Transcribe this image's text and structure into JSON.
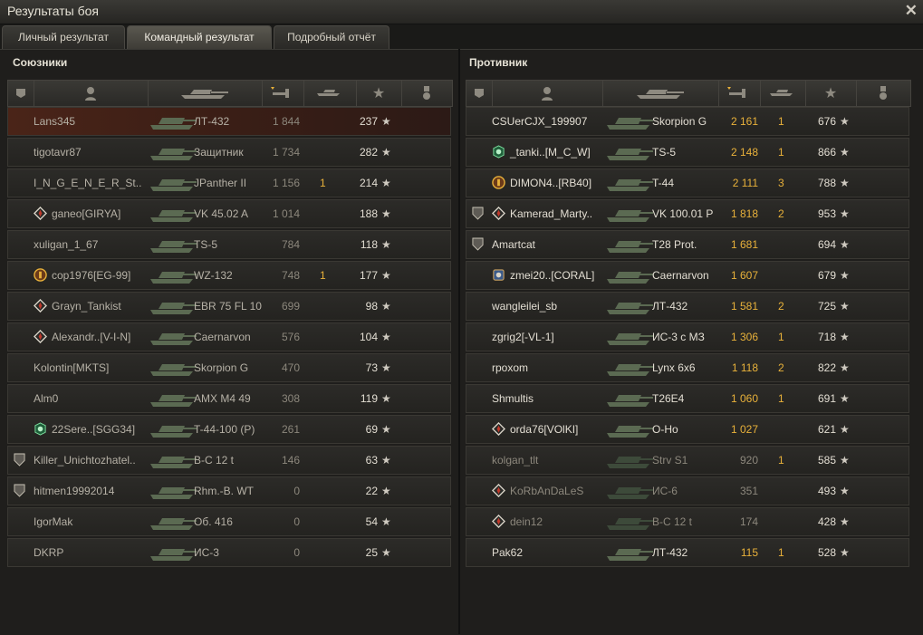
{
  "window": {
    "title": "Результаты боя",
    "close": "✕"
  },
  "tabs": [
    {
      "label": "Личный результат",
      "active": false
    },
    {
      "label": "Командный результат",
      "active": true
    },
    {
      "label": "Подробный отчёт",
      "active": false
    }
  ],
  "allies": {
    "title": "Союзники",
    "rows": [
      {
        "name": "Lans345",
        "tank": "ЛТ-432",
        "damage": "1 844",
        "frags": "",
        "xp": "237",
        "badge": "",
        "me": true
      },
      {
        "name": "tigotavr87",
        "tank": "Защитник",
        "damage": "1 734",
        "frags": "",
        "xp": "282",
        "badge": ""
      },
      {
        "name": "I_N_G_E_N_E_R_St..",
        "tank": "JPanther II",
        "damage": "1 156",
        "frags": "1",
        "xp": "214",
        "badge": ""
      },
      {
        "name": "ganeo[GIRYA]",
        "tank": "VK 45.02 A",
        "damage": "1 014",
        "frags": "",
        "xp": "188",
        "badge": "diamond"
      },
      {
        "name": "xuligan_1_67",
        "tank": "TS-5",
        "damage": "784",
        "frags": "",
        "xp": "118",
        "badge": ""
      },
      {
        "name": "cop1976[EG-99]",
        "tank": "WZ-132",
        "damage": "748",
        "frags": "1",
        "xp": "177",
        "badge": "emblem"
      },
      {
        "name": "Grayn_Tankist",
        "tank": "EBR 75 FL 10",
        "damage": "699",
        "frags": "",
        "xp": "98",
        "badge": "diamond"
      },
      {
        "name": "Alexandr..[V-I-N]",
        "tank": "Caernarvon",
        "damage": "576",
        "frags": "",
        "xp": "104",
        "badge": "diamond"
      },
      {
        "name": "Kolontin[MKTS]",
        "tank": "Skorpion G",
        "damage": "470",
        "frags": "",
        "xp": "73",
        "badge": ""
      },
      {
        "name": "Alm0",
        "tank": "AMX M4 49",
        "damage": "308",
        "frags": "",
        "xp": "119",
        "badge": ""
      },
      {
        "name": "22Sere..[SGG34]",
        "tank": "T-44-100 (P)",
        "damage": "261",
        "frags": "",
        "xp": "69",
        "badge": "green"
      },
      {
        "name": "Killer_Unichtozhatel..",
        "tank": "B-C 12 t",
        "damage": "146",
        "frags": "",
        "xp": "63",
        "badge": "",
        "shield": true
      },
      {
        "name": "hitmen19992014",
        "tank": "Rhm.-B. WT",
        "damage": "0",
        "frags": "",
        "xp": "22",
        "badge": "",
        "shield": true
      },
      {
        "name": "IgorMak",
        "tank": "Об. 416",
        "damage": "0",
        "frags": "",
        "xp": "54",
        "badge": ""
      },
      {
        "name": "DKRP",
        "tank": "ИС-3",
        "damage": "0",
        "frags": "",
        "xp": "25",
        "badge": ""
      }
    ]
  },
  "enemies": {
    "title": "Противник",
    "rows": [
      {
        "name": "CSUerCJX_199907",
        "tank": "Skorpion G",
        "damage": "2 161",
        "frags": "1",
        "xp": "676",
        "badge": ""
      },
      {
        "name": "_tanki..[M_C_W]",
        "tank": "TS-5",
        "damage": "2 148",
        "frags": "1",
        "xp": "866",
        "badge": "green"
      },
      {
        "name": "DIMON4..[RB40]",
        "tank": "T-44",
        "damage": "2 111",
        "frags": "3",
        "xp": "788",
        "badge": "emblem"
      },
      {
        "name": "Kamerad_Marty..",
        "tank": "VK 100.01 P",
        "damage": "1 818",
        "frags": "2",
        "xp": "953",
        "badge": "diamond",
        "shield": true
      },
      {
        "name": "Amartcat",
        "tank": "T28 Prot.",
        "damage": "1 681",
        "frags": "",
        "xp": "694",
        "badge": "",
        "shield": true
      },
      {
        "name": "zmei20..[CORAL]",
        "tank": "Caernarvon",
        "damage": "1 607",
        "frags": "",
        "xp": "679",
        "badge": "blue"
      },
      {
        "name": "wangleilei_sb",
        "tank": "ЛТ-432",
        "damage": "1 581",
        "frags": "2",
        "xp": "725",
        "badge": ""
      },
      {
        "name": "zgrig2[-VL-1]",
        "tank": "ИС-3 с МЗ",
        "damage": "1 306",
        "frags": "1",
        "xp": "718",
        "badge": ""
      },
      {
        "name": "rpoxom",
        "tank": "Lynx 6x6",
        "damage": "1 118",
        "frags": "2",
        "xp": "822",
        "badge": ""
      },
      {
        "name": "Shmultis",
        "tank": "T26E4",
        "damage": "1 060",
        "frags": "1",
        "xp": "691",
        "badge": ""
      },
      {
        "name": "orda76[VOlKI]",
        "tank": "O-Ho",
        "damage": "1 027",
        "frags": "",
        "xp": "621",
        "badge": "diamond"
      },
      {
        "name": "kolgan_tlt",
        "tank": "Strv S1",
        "damage": "920",
        "frags": "1",
        "xp": "585",
        "badge": "",
        "dead": true
      },
      {
        "name": "KoRbAnDaLeS",
        "tank": "ИС-6",
        "damage": "351",
        "frags": "",
        "xp": "493",
        "badge": "diamond",
        "dead": true
      },
      {
        "name": "dein12",
        "tank": "B-C 12 t",
        "damage": "174",
        "frags": "",
        "xp": "428",
        "badge": "diamond",
        "dead": true
      },
      {
        "name": "Pak62",
        "tank": "ЛТ-432",
        "damage": "115",
        "frags": "1",
        "xp": "528",
        "badge": ""
      }
    ]
  },
  "header_icons": [
    "squad-icon",
    "player-icon",
    "tank-icon",
    "damage-icon",
    "frags-icon",
    "xp-icon",
    "medal-icon"
  ],
  "colors": {
    "gold": "#e8b13a",
    "player_row": "#4a2418"
  }
}
